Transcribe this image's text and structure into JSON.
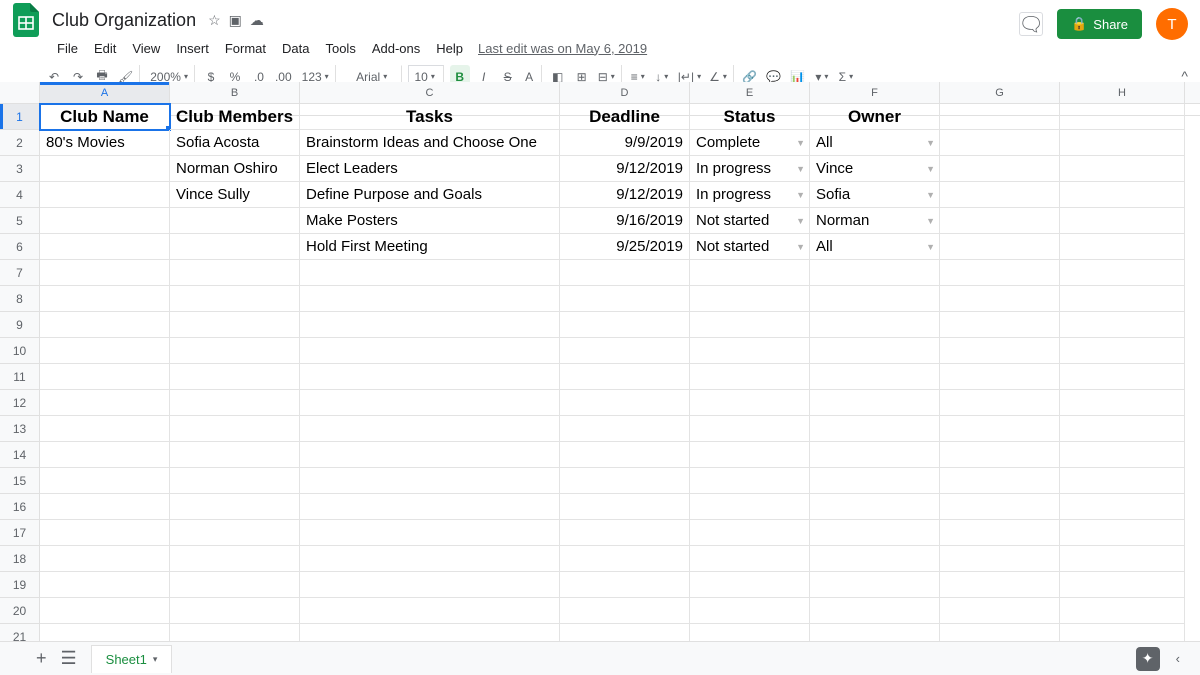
{
  "doc": {
    "title": "Club Organization",
    "last_edit": "Last edit was on May 6, 2019"
  },
  "menus": [
    "File",
    "Edit",
    "View",
    "Insert",
    "Format",
    "Data",
    "Tools",
    "Add-ons",
    "Help"
  ],
  "share": {
    "label": "Share",
    "avatar": "T"
  },
  "toolbar": {
    "zoom": "200%",
    "font": "Arial",
    "size": "10"
  },
  "formula": {
    "name_box": "A1",
    "value": "Club Name"
  },
  "columns": [
    "A",
    "B",
    "C",
    "D",
    "E",
    "F",
    "G",
    "H"
  ],
  "row_count": 21,
  "headers": {
    "A": "Club Name",
    "B": "Club Members",
    "C": "Tasks",
    "D": "Deadline",
    "E": "Status",
    "F": "Owner"
  },
  "rows_data": [
    {
      "A": "80's Movies",
      "B": "Sofia Acosta",
      "C": "Brainstorm Ideas and Choose One",
      "D": "9/9/2019",
      "E": "Complete",
      "F": "All"
    },
    {
      "A": "",
      "B": "Norman Oshiro",
      "C": "Elect Leaders",
      "D": "9/12/2019",
      "E": "In progress",
      "F": "Vince"
    },
    {
      "A": "",
      "B": "Vince Sully",
      "C": "Define Purpose and Goals",
      "D": "9/12/2019",
      "E": "In progress",
      "F": "Sofia"
    },
    {
      "A": "",
      "B": "",
      "C": "Make Posters",
      "D": "9/16/2019",
      "E": "Not started",
      "F": "Norman"
    },
    {
      "A": "",
      "B": "",
      "C": "Hold First Meeting",
      "D": "9/25/2019",
      "E": "Not started",
      "F": "All"
    }
  ],
  "sheet": {
    "name": "Sheet1"
  }
}
